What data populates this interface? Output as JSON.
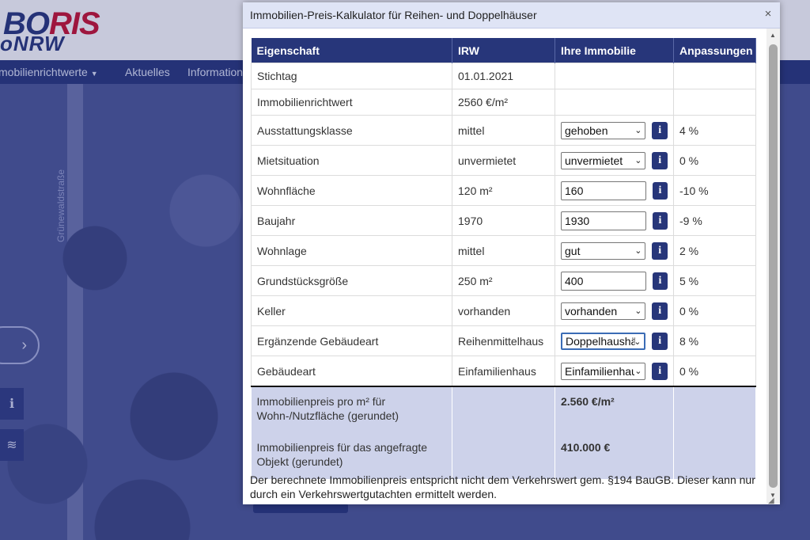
{
  "background": {
    "logo_line1_a": "BO",
    "logo_line1_b": "RIS",
    "logo_line2": "oNRW",
    "nav": {
      "item1": "mobilienrichtwerte",
      "item1_caret": "▼",
      "item2": "Aktuelles",
      "item3": "Information"
    },
    "road_label": "Grünewaldstraße",
    "icons": {
      "arrow": "chevron-right-icon",
      "info": "info-icon",
      "layers": "layers-icon"
    }
  },
  "dialog": {
    "title": "Immobilien-Preis-Kalkulator für Reihen- und Doppelhäuser",
    "close": "×",
    "headers": {
      "property": "Eigenschaft",
      "irw": "IRW",
      "yours": "Ihre Immobilie",
      "adjust": "Anpassungen"
    },
    "rows": [
      {
        "property": "Stichtag",
        "irw": "01.01.2021",
        "yours": "",
        "adjust": ""
      },
      {
        "property": "Immobilienrichtwert",
        "irw": "2560 €/m²",
        "yours": "",
        "adjust": ""
      },
      {
        "property": "Ausstattungsklasse",
        "irw": "mittel",
        "yours": "gehoben",
        "adjust": "4 %"
      },
      {
        "property": "Mietsituation",
        "irw": "unvermietet",
        "yours": "unvermietet",
        "adjust": "0 %"
      },
      {
        "property": "Wohnfläche",
        "irw": "120 m²",
        "yours": "160",
        "adjust": "-10 %"
      },
      {
        "property": "Baujahr",
        "irw": "1970",
        "yours": "1930",
        "adjust": "-9 %"
      },
      {
        "property": "Wohnlage",
        "irw": "mittel",
        "yours": "gut",
        "adjust": "2 %"
      },
      {
        "property": "Grundstücksgröße",
        "irw": "250 m²",
        "yours": "400",
        "adjust": "5 %"
      },
      {
        "property": "Keller",
        "irw": "vorhanden",
        "yours": "vorhanden",
        "adjust": "0 %"
      },
      {
        "property": "Ergänzende Gebäudeart",
        "irw": "Reihenmittelhaus",
        "yours": "Doppelhaushälfte",
        "adjust": "8 %"
      },
      {
        "property": "Gebäudeart",
        "irw": "Einfamilienhaus",
        "yours": "Einfamilienhaus",
        "adjust": "0 %"
      }
    ],
    "info_glyph": "i",
    "summary": [
      {
        "label_line1": "Immobilienpreis pro m² für",
        "label_line2": "Wohn-/Nutzfläche (gerundet)",
        "value": "2.560 €/m²"
      },
      {
        "label_line1": "Immobilienpreis für das angefragte",
        "label_line2": "Objekt (gerundet)",
        "value": "410.000 €"
      }
    ],
    "note": "Der berechnete Immobilienpreis entspricht nicht dem Verkehrswert gem. §194 BauGB. Dieser kann nur durch ein Verkehrswertgutachten ermittelt werden."
  },
  "colors": {
    "primary": "#27367a",
    "titlebar": "#dfe4f5",
    "summary_bg": "#cdd2ea",
    "logo_red": "#c8102e"
  }
}
